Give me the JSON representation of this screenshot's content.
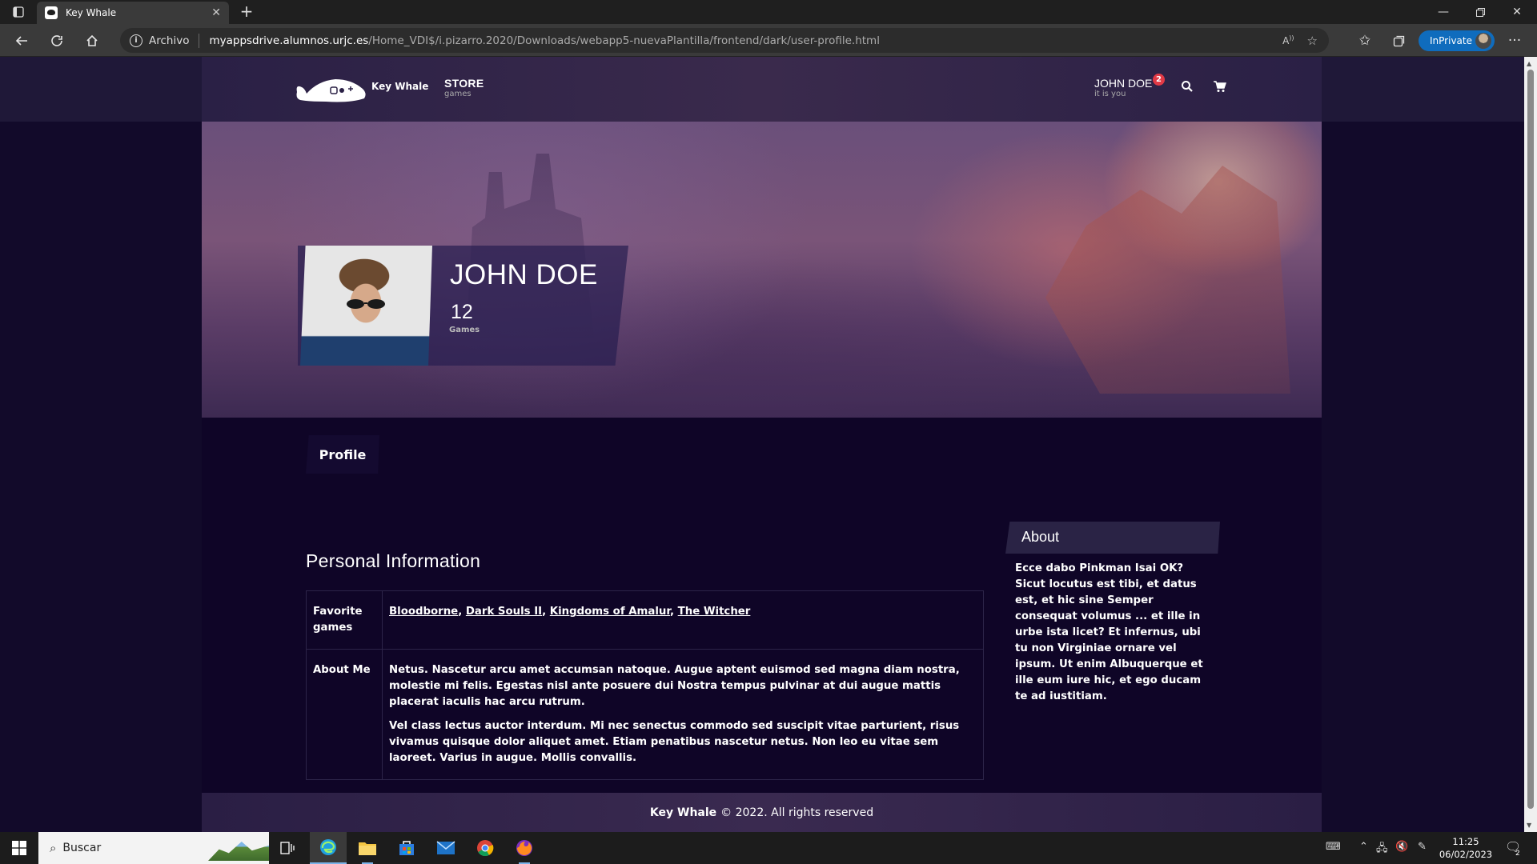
{
  "browser": {
    "tab_title": "Key Whale",
    "address_label": "Archivo",
    "url_host": "myappsdrive.alumnos.urjc.es",
    "url_path": "/Home_VDI$/i.pizarro.2020/Downloads/webapp5-nuevaPlantilla/frontend/dark/user-profile.html",
    "inprivate_label": "InPrivate"
  },
  "header": {
    "brand": "Key Whale",
    "store_label": "STORE",
    "store_sub": "games",
    "user_label": "JOHN DOE",
    "user_sub": "it is you",
    "notification_count": "2"
  },
  "profile": {
    "name": "JOHN DOE",
    "games_count": "12",
    "games_label": "Games",
    "tab_label": "Profile"
  },
  "personal_info": {
    "title": "Personal Information",
    "favorite_games_label_1": "Favorite",
    "favorite_games_label_2": "games",
    "favorite_games": [
      "Bloodborne",
      "Dark Souls II",
      "Kingdoms of Amalur",
      "The Witcher"
    ],
    "about_me_label": "About Me",
    "about_me_p1": "Netus. Nascetur arcu amet accumsan natoque. Augue aptent euismod sed magna diam nostra, molestie mi felis. Egestas nisl ante posuere dui Nostra tempus pulvinar at dui augue mattis placerat iaculis hac arcu rutrum.",
    "about_me_p2_a": "Vel ",
    "about_me_p2_b": "class",
    "about_me_p2_c": " lectus auctor interdum. Mi ",
    "about_me_p2_d": "nec",
    "about_me_p2_e": " senectus commodo sed suscipit vitae parturient, risus vivamus quisque dolor aliquet amet. Etiam penatibus nascetur netus. Non leo eu vitae sem laoreet. Varius in augue. Mollis convallis."
  },
  "about": {
    "title": "About",
    "text": "Ecce dabo Pinkman Isai OK? Sicut locutus est tibi, et datus est, et hic sine Semper consequat volumus ... et ille in urbe ista licet? Et infernus, ubi tu non Virginiae ornare vel ipsum. Ut enim Albuquerque et ille eum iure hic, et ego ducam te ad iustitiam."
  },
  "footer": {
    "brand": "Key Whale",
    "rights": "© 2022. All rights reserved"
  },
  "taskbar": {
    "search_placeholder": "Buscar",
    "time": "11:25",
    "date": "06/02/2023",
    "notification_count": "2"
  },
  "colors": {
    "content_bg": "#0f0527",
    "header_bg": "#2a2045",
    "badge": "#e23a46",
    "inprivate": "#0f6cbd"
  }
}
